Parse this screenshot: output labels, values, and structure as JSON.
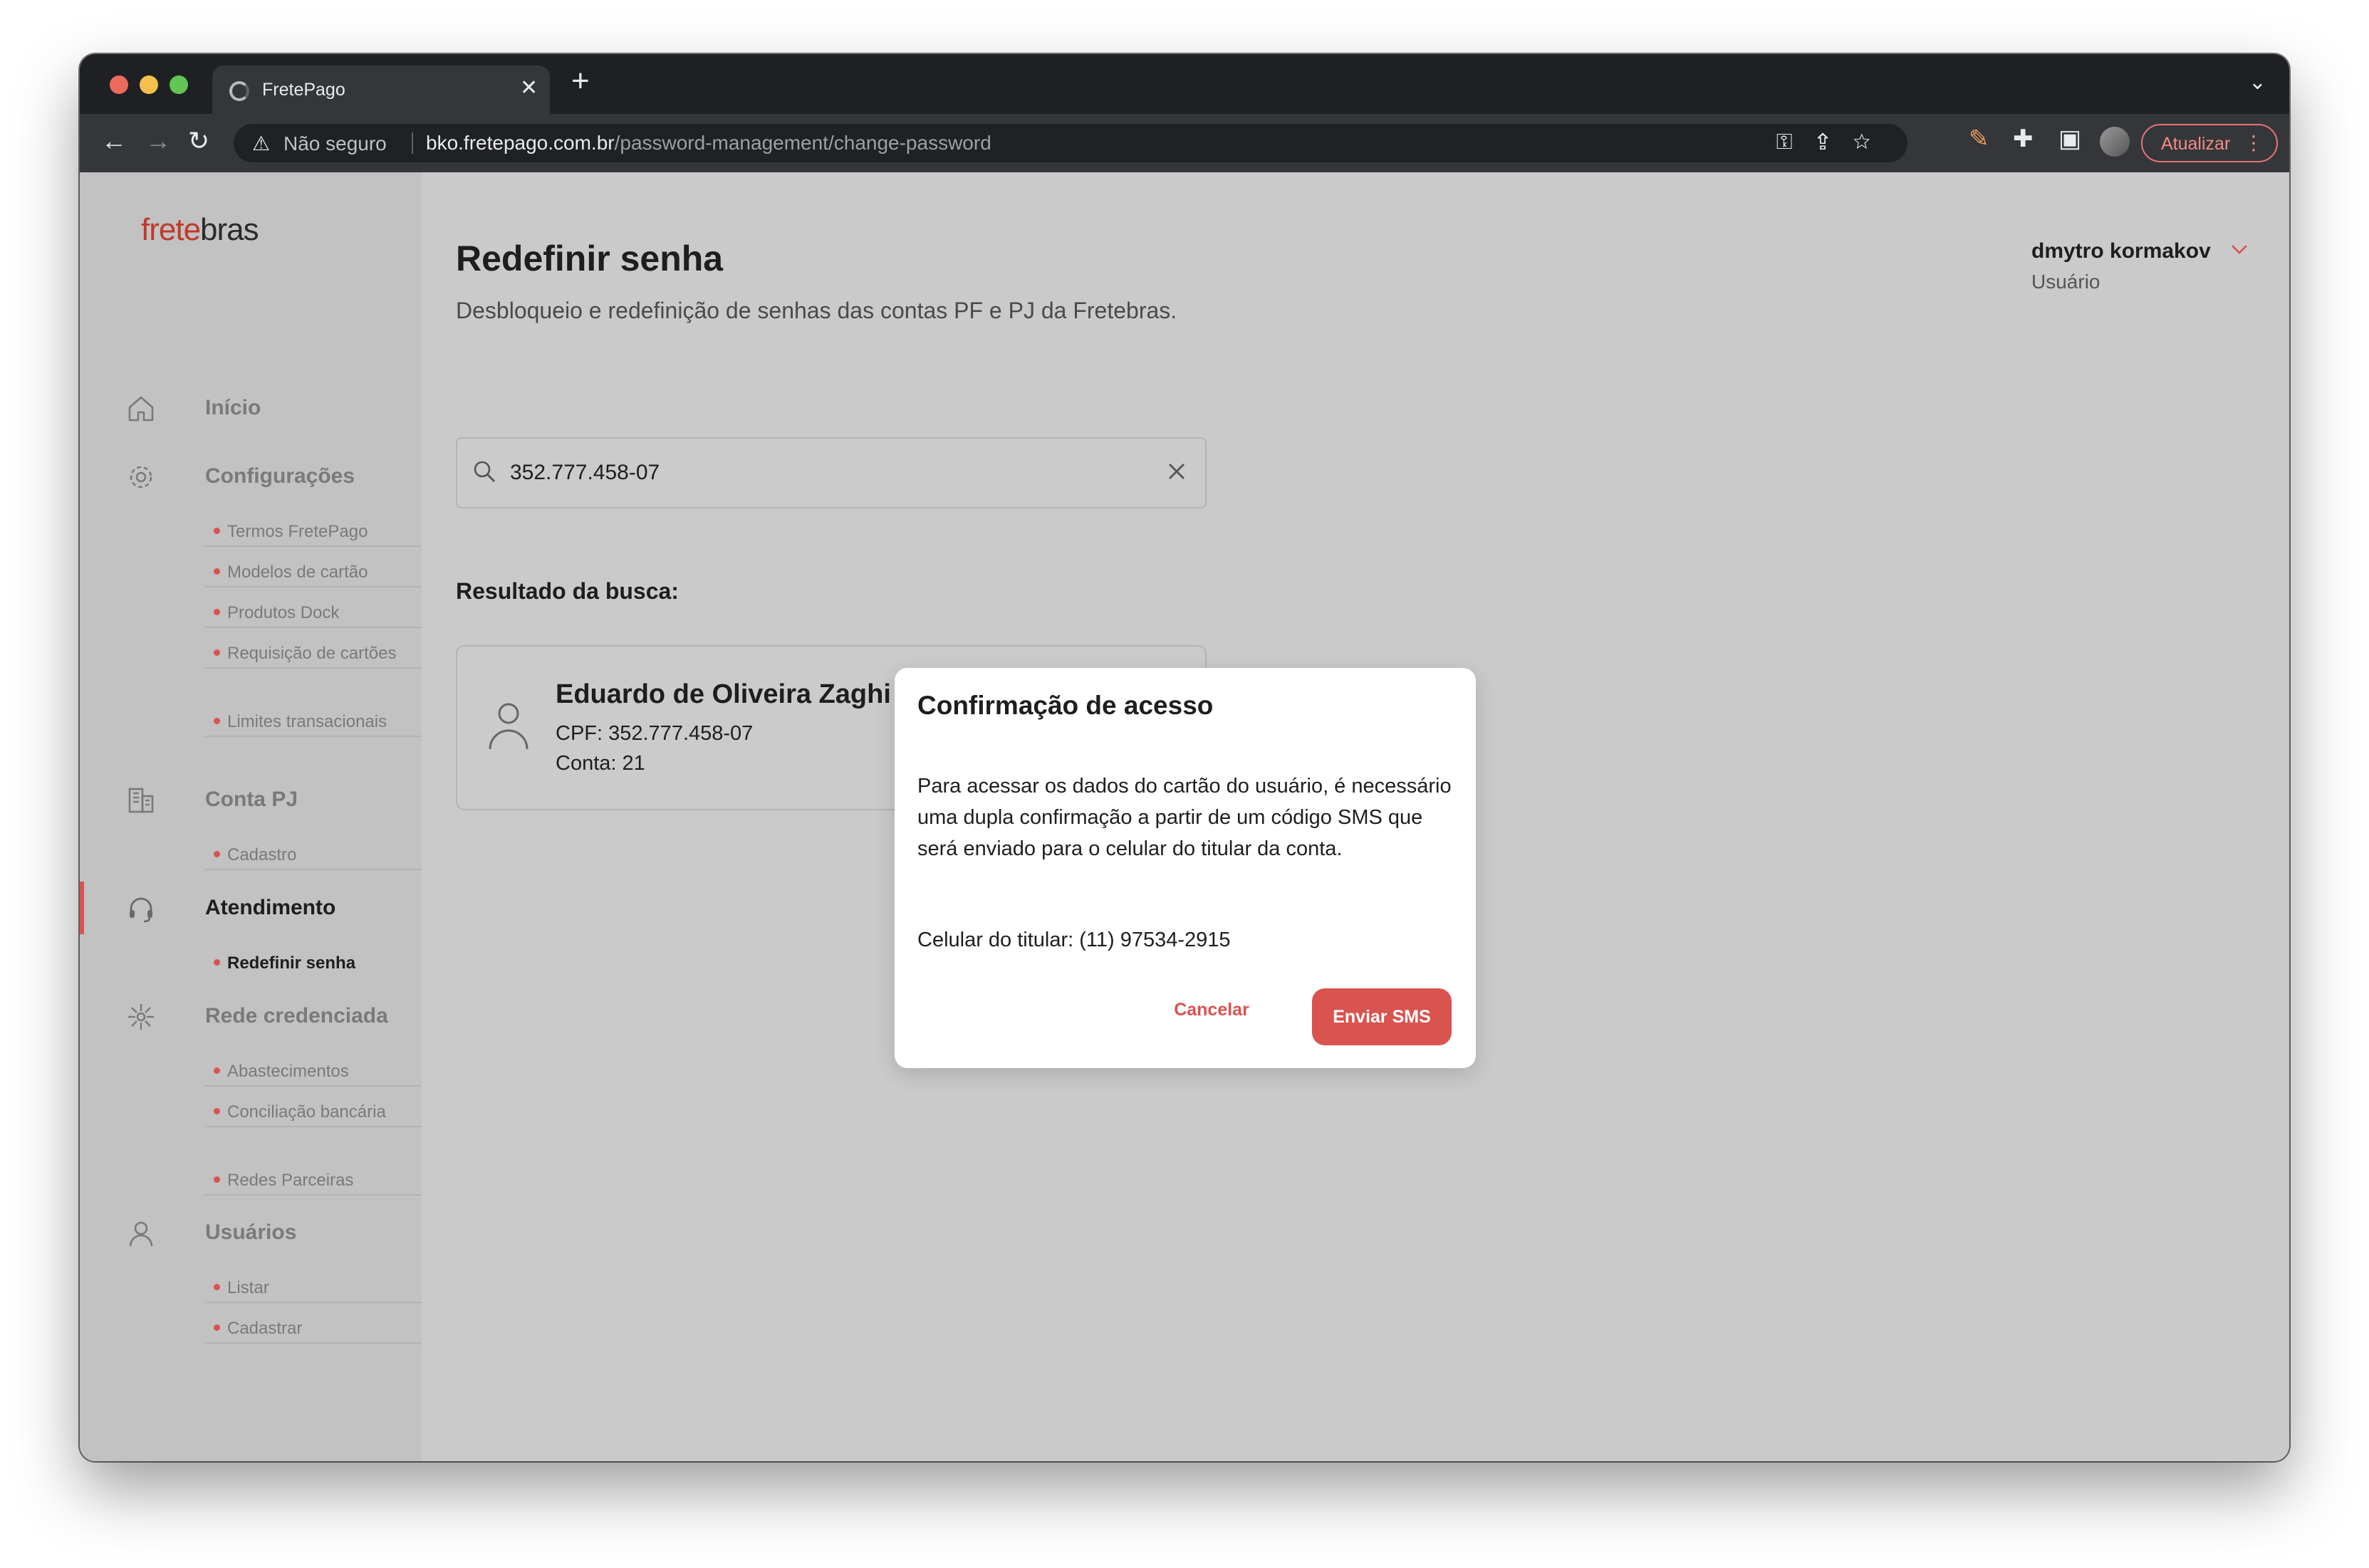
{
  "browser": {
    "tab_title": "FretePago",
    "tab_close": "✕",
    "new_tab": "+",
    "tabs_menu": "⌄",
    "security_label": "Não seguro",
    "url_host": "bko.fretepago.com.br",
    "url_path": "/password-management/change-password",
    "update_label": "Atualizar"
  },
  "logo": {
    "part1": "frete",
    "part2": "bras"
  },
  "sidebar": {
    "items": [
      {
        "label": "Início"
      },
      {
        "label": "Configurações",
        "sub": [
          "Termos FretePago",
          "Modelos de cartão",
          "Produtos Dock",
          "Requisição de cartões",
          "Limites transacionais"
        ]
      },
      {
        "label": "Conta PJ",
        "sub": [
          "Cadastro"
        ]
      },
      {
        "label": "Atendimento",
        "sub": [
          "Redefinir senha"
        ]
      },
      {
        "label": "Rede credenciada",
        "sub": [
          "Abastecimentos",
          "Conciliação bancária",
          "Redes Parceiras"
        ]
      },
      {
        "label": "Usuários",
        "sub": [
          "Listar",
          "Cadastrar"
        ]
      }
    ]
  },
  "header": {
    "title": "Redefinir senha",
    "subtitle": "Desbloqueio e redefinição de senhas das contas PF e PJ da Fretebras.",
    "user_name": "dmytro kormakov",
    "user_role": "Usuário"
  },
  "search": {
    "value": "352.777.458-07"
  },
  "results": {
    "label": "Resultado da busca:",
    "name": "Eduardo de Oliveira Zaghi",
    "cpf": "CPF: 352.777.458-07",
    "account": "Conta: 21"
  },
  "modal": {
    "title": "Confirmação de acesso",
    "body": "Para acessar os dados do cartão do usuário, é necessário uma dupla confirmação a partir de um código SMS que será enviado para o celular do titular da conta.",
    "phone": "Celular do titular: (11) 97534-2915",
    "cancel_label": "Cancelar",
    "send_label": "Enviar SMS"
  },
  "colors": {
    "accent": "#d9534f",
    "sidebar_bg": "#c2c2c2",
    "page_bg": "#cacaca"
  }
}
